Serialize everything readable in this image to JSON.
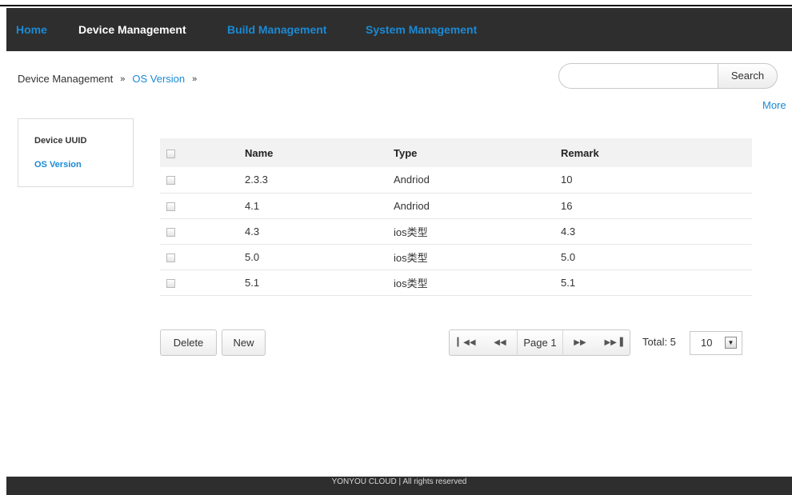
{
  "nav": {
    "home": "Home",
    "device_management": "Device Management",
    "build_management": "Build Management",
    "system_management": "System Management"
  },
  "breadcrumb": {
    "root": "Device Management",
    "separator": "»",
    "current": "OS Version",
    "trailing_separator": "»"
  },
  "search": {
    "placeholder": "",
    "value": "",
    "button_label": "Search"
  },
  "more_label": "More",
  "sidebar": {
    "items": [
      {
        "label": "Device UUID",
        "active": false
      },
      {
        "label": "OS Version",
        "active": true
      }
    ]
  },
  "table": {
    "columns": [
      "Name",
      "Type",
      "Remark"
    ],
    "rows": [
      {
        "name": "2.3.3",
        "type": "Andriod",
        "remark": "10"
      },
      {
        "name": "4.1",
        "type": "Andriod",
        "remark": "16"
      },
      {
        "name": "4.3",
        "type": "ios类型",
        "remark": "4.3"
      },
      {
        "name": "5.0",
        "type": "ios类型",
        "remark": "5.0"
      },
      {
        "name": "5.1",
        "type": "ios类型",
        "remark": "5.1"
      }
    ]
  },
  "actions": {
    "delete_label": "Delete",
    "new_label": "New"
  },
  "pagination": {
    "first_icon": "first-page-icon",
    "prev_icon": "previous-page-icon",
    "page_label": "Page 1",
    "next_icon": "next-page-icon",
    "last_icon": "last-page-icon",
    "total_label": "Total: 5",
    "page_size": "10"
  },
  "footer": {
    "text": "YONYOU CLOUD | All rights reserved"
  },
  "colors": {
    "nav_background": "#2e2e2e",
    "link_blue": "#1a8ad6",
    "header_row_background": "#f2f2f2"
  }
}
